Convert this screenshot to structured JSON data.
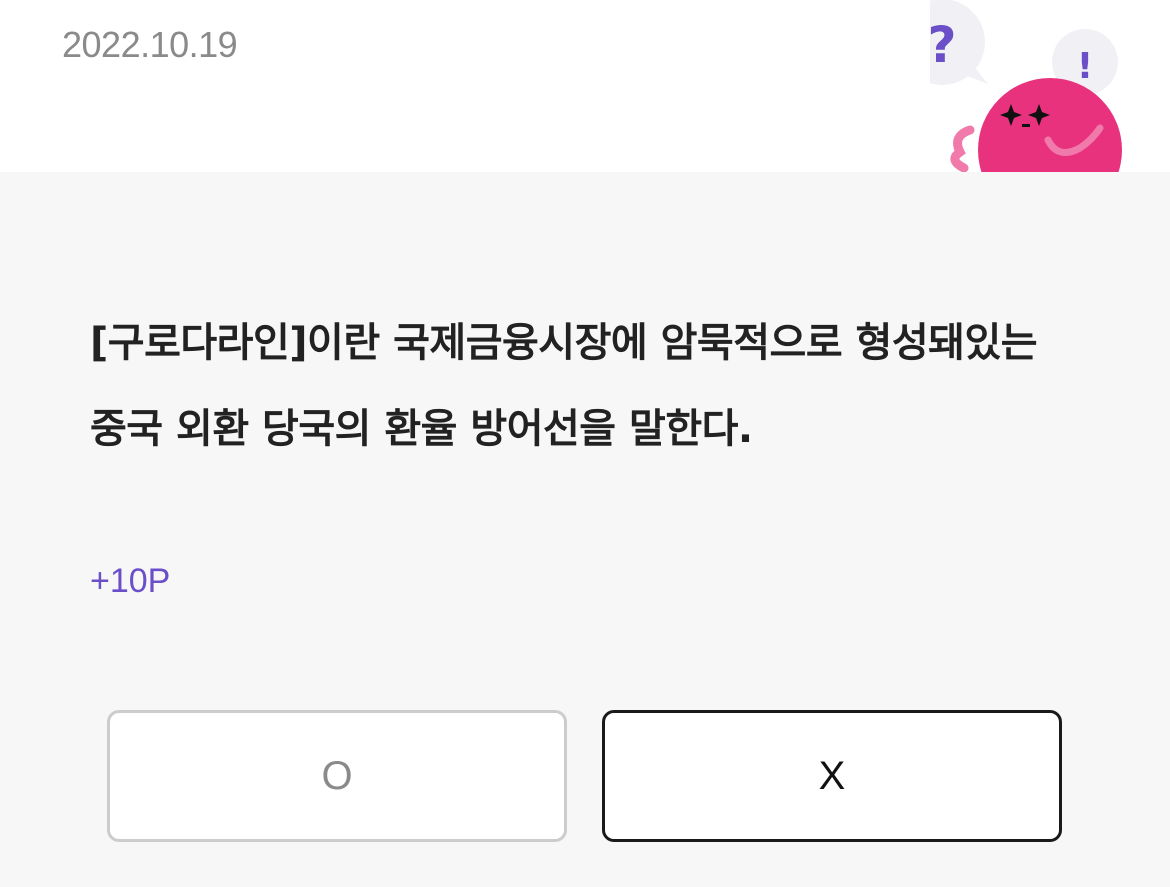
{
  "header": {
    "date": "2022.10.19"
  },
  "mascot": {
    "question_mark": "?",
    "exclamation_mark": "!",
    "body_color": "#e8327e",
    "bubble_color": "#f1f1f5",
    "symbol_color": "#6a4fc8"
  },
  "quiz": {
    "question": "[구로다라인]이란 국제금융시장에 암묵적으로 형성돼있는 중국 외환 당국의 환율 방어선을 말한다.",
    "points": "+10P"
  },
  "answers": {
    "o_label": "O",
    "x_label": "X"
  },
  "colors": {
    "accent": "#6a4fc8",
    "card_background": "#f7f7f7"
  }
}
